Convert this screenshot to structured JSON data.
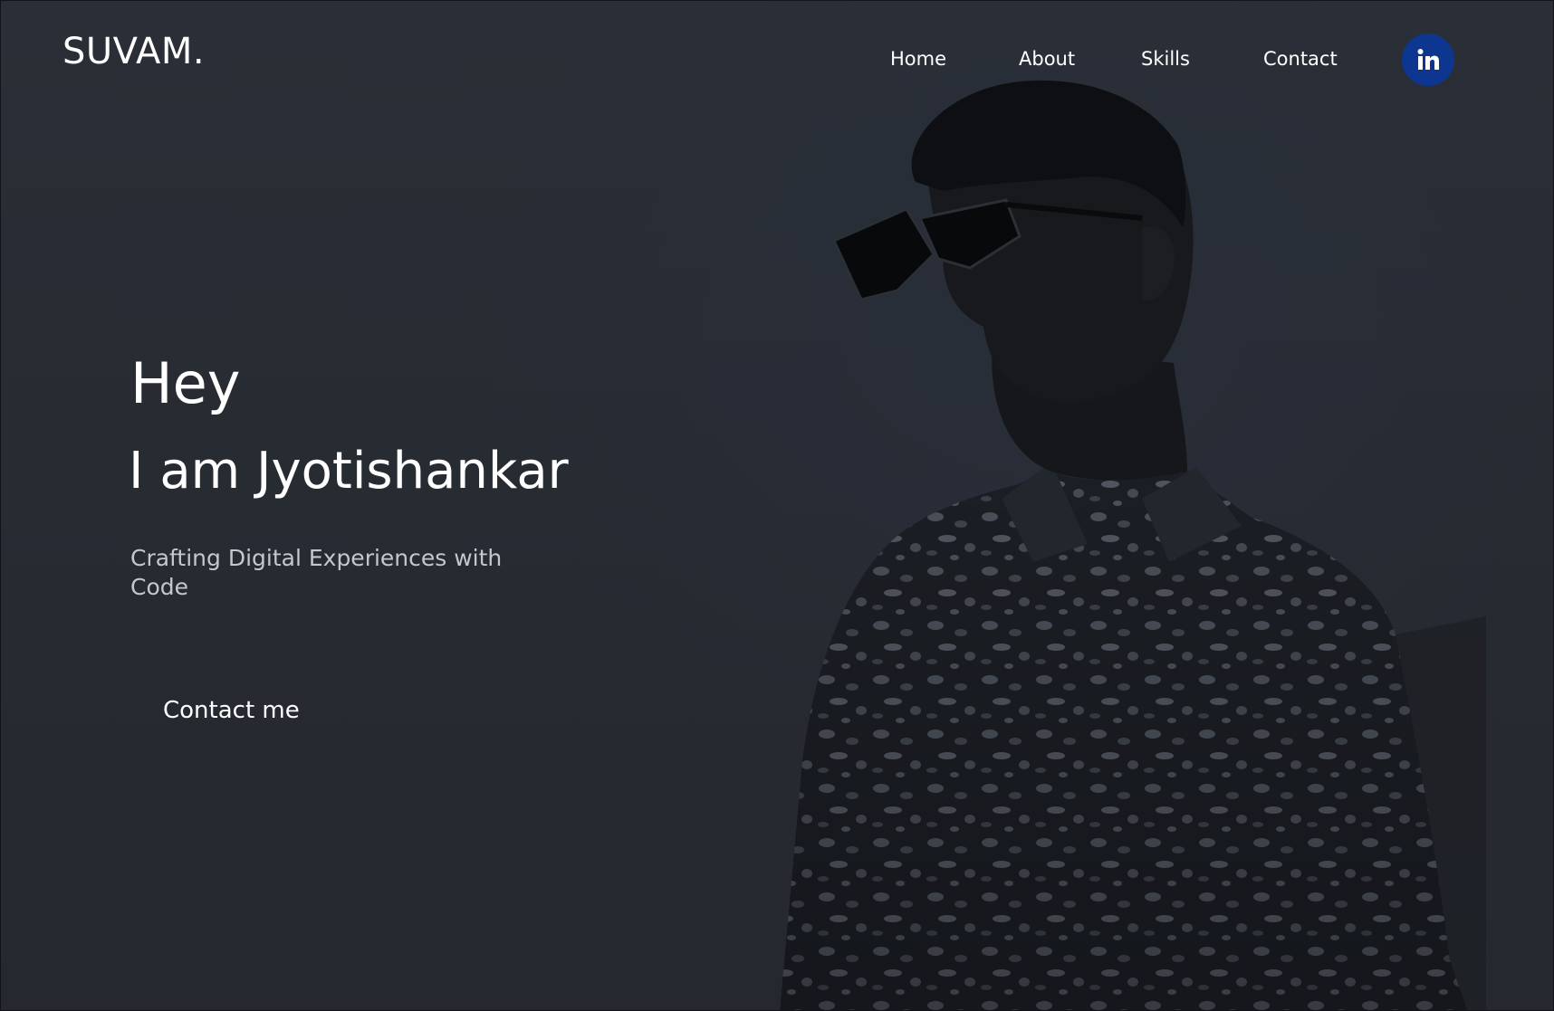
{
  "brand": {
    "logo_text": "SUVAM."
  },
  "nav": {
    "items": [
      {
        "label": "Home"
      },
      {
        "label": "About"
      },
      {
        "label": "Skills"
      },
      {
        "label": "Contact"
      }
    ],
    "social": {
      "icon": "linkedin-icon",
      "label": "in",
      "color": "#0d3690"
    }
  },
  "hero": {
    "greeting": "Hey",
    "name_line": "I am Jyotishankar",
    "tagline": "Crafting Digital Experiences with Code",
    "cta_label": "Contact me"
  },
  "theme": {
    "background": "#262a31",
    "text": "#ffffff",
    "muted_text": "#c4c7cc"
  }
}
